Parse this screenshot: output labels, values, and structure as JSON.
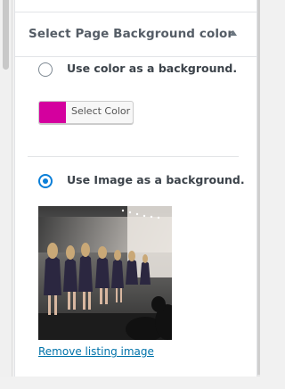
{
  "section": {
    "title": "Select Page Background color"
  },
  "options": {
    "color": {
      "label": "Use color as a background.",
      "selected": false
    },
    "image": {
      "label": "Use Image as a background.",
      "selected": true
    }
  },
  "color_picker": {
    "button_label": "Select Color",
    "current_color": "#d4009e"
  },
  "image": {
    "remove_link": "Remove listing image"
  },
  "colors": {
    "accent": "#0a7fd8",
    "link": "#0073aa"
  }
}
